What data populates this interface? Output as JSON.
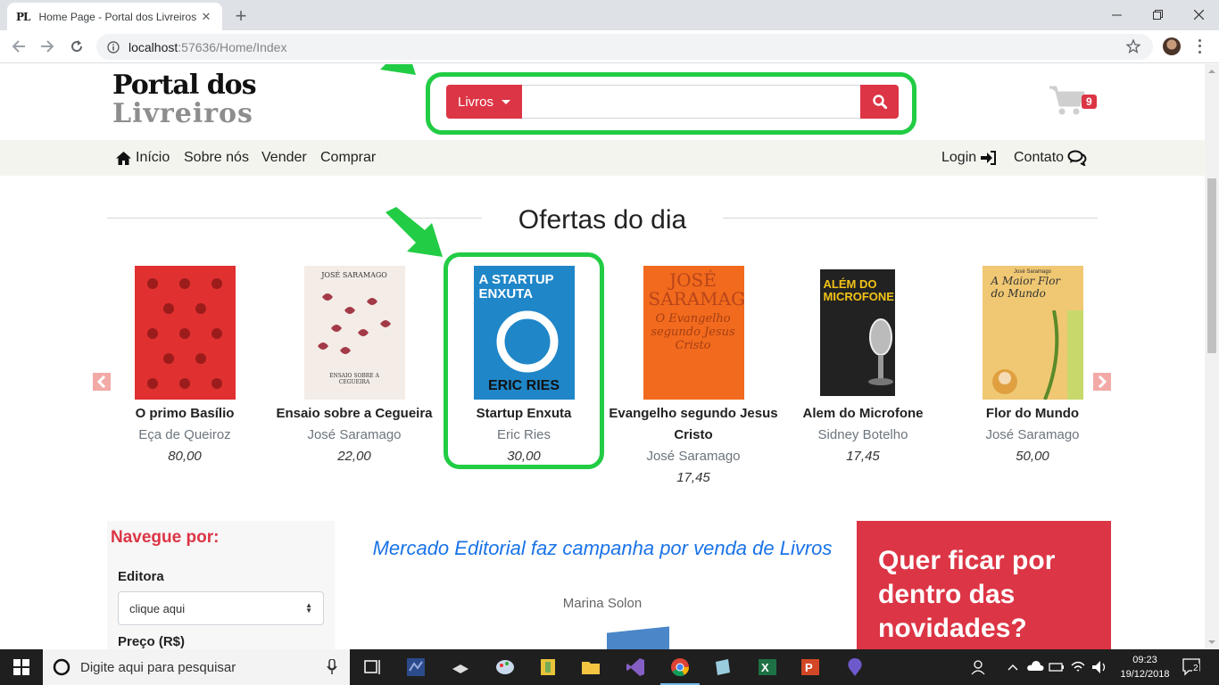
{
  "browser": {
    "tab_title": "Home Page - Portal dos Livreiros",
    "tab_favicon": "PL",
    "url_host": "localhost",
    "url_rest": ":57636/Home/Index"
  },
  "header": {
    "logo_line1": "Portal dos",
    "logo_line2": "Livreiros",
    "category_label": "Livros",
    "search_value": "",
    "cart_count": "9"
  },
  "nav": {
    "home": "Início",
    "about": "Sobre nós",
    "sell": "Vender",
    "buy": "Comprar",
    "login": "Login",
    "contact": "Contato"
  },
  "section_title": "Ofertas do dia",
  "books": [
    {
      "title": "O primo Basílio",
      "author": "Eça de Queiroz",
      "price": "80,00"
    },
    {
      "title": "Ensaio sobre a Cegueira",
      "author": "José Saramago",
      "price": "22,00",
      "cover_text": "JOSÉ SARAMAGO",
      "cover_sub": "ENSAIO SOBRE A CEGUEIRA"
    },
    {
      "title": "Startup Enxuta",
      "author": "Eric Ries",
      "price": "30,00",
      "cover_text": "A STARTUP ENXUTA",
      "cover_sub": "ERIC RIES"
    },
    {
      "title": "Evangelho segundo Jesus Cristo",
      "author": "José Saramago",
      "price": "17,45",
      "cover_text": "JOSÉ SARAMAGO",
      "cover_sub": "O Evangelho segundo Jesus Cristo"
    },
    {
      "title": "Alem do Microfone",
      "author": "Sidney Botelho",
      "price": "17,45",
      "cover_text": "ALÉM DO MICROFONE"
    },
    {
      "title": "Flor do Mundo",
      "author": "José Saramago",
      "price": "50,00",
      "cover_text": "A Maior Flor do Mundo",
      "cover_sub": "José Saramago"
    }
  ],
  "sidebar": {
    "title": "Navegue por:",
    "publisher_label": "Editora",
    "publisher_value": "clique aqui",
    "price_label": "Preço (R$)"
  },
  "news": {
    "title": "Mercado Editorial faz campanha por venda de Livros",
    "author": "Marina Solon"
  },
  "promo": {
    "text": "Quer ficar por dentro das novidades?"
  },
  "taskbar": {
    "search_placeholder": "Digite aqui para pesquisar",
    "time": "09:23",
    "date": "19/12/2018",
    "notifications": "2"
  }
}
